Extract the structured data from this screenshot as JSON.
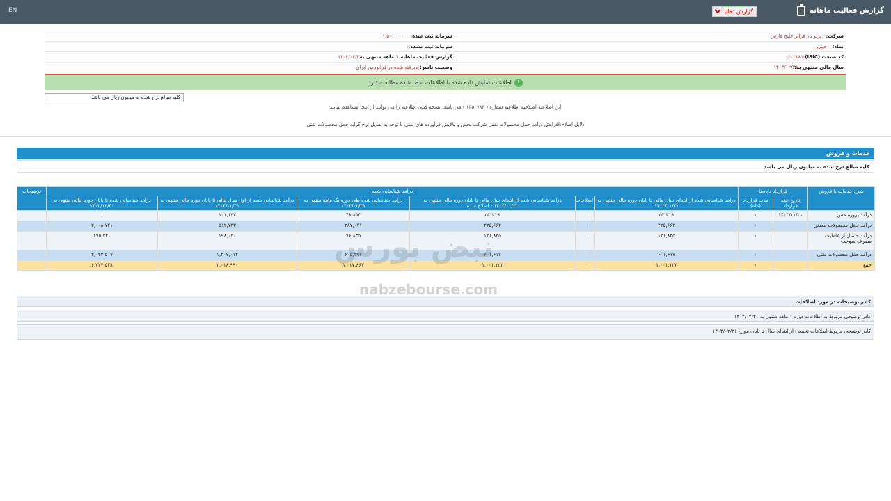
{
  "topbar": {
    "lang": "EN",
    "title": "گزارش فعالیت ماهانه",
    "select_value": "گزارش تخالیت"
  },
  "info": {
    "company_label": "شرکت:",
    "company_value": "پرتو بار فرابر خلیج فارس",
    "symbol_label": "نماد:",
    "symbol_value": "حپترو",
    "isic_label": "کد صنعت (ISIC):",
    "isic_value": "۶۰۲۱۸۱",
    "fiscal_label": "سال مالی منتهی به:",
    "fiscal_value": "۱۴۰۴/۱۲/۲۹",
    "reg_capital_label": "سرمایه ثبت شده:",
    "reg_capital_value": "۱,۵۰۰,۰۰۰",
    "unreg_capital_label": "سرمایه ثبت نشده:",
    "unreg_capital_value": "۰",
    "report_label": "گزارش فعالیت ماهانه ۱ ماهه منتهی به",
    "report_value": "۱۴۰۴/۰۲/۳۱",
    "status_label": "وضعیت ناشر:",
    "status_value": "پذیرفته شده در فرابورس ایران"
  },
  "green_msg": "اطلاعات نمایش داده شده با اطلاعات امضا شده مطابقت دارد",
  "unit_box": "کلیه مبالغ درج شده به میلیون ریال می باشد",
  "note1": "این اطلاعیه اصلاحیه اطلاعیه شماره ( ۱۳۵۰۷۸۴ ) می باشد. نسخه قبلی اطلاعیه را می توانید از اینجا مشاهده نمایید",
  "note2": "دلایل اصلاح:افزایش درآمد حمل محصولات نفتی شرکت پخش و پالایش فرآورده هاي نفتي با توجه به تعدیل نرخ کرایه حمل محصولات نفتي",
  "section": {
    "title": "خدمات و فروش",
    "subtitle": "کلیه مبالغ درج شده به میلیون ریال می باشد"
  },
  "table": {
    "h_service": "شرح خدمات یا فروش",
    "h_contract": "قرارداد داده‌ها",
    "h_contract_date": "تاریخ عقد قرارداد",
    "h_contract_duration": "مدت قرارداد (ماه)",
    "h_revenue": "درآمد شناسایی شده",
    "h_explanations": "توضیحات",
    "h_rev_1": "درآمد شناسایی شده از ابتدای سال مالی تا پایان دوره مالی منتهی به ۱۴۰۴/۰۱/۳۱",
    "h_corrections": "اصلاحات",
    "h_rev_2": "درآمد شناسایی شده از ابتدای سال مالی تا پایان دوره مالی منتهی به ۱۴۰۴/۰۱/۳۱ - اصلاح شده",
    "h_rev_3": "درآمد شناسایی شده طی دوره یک ماهه منتهی به ۱۴۰۴/۰۲/۳۱",
    "h_rev_4": "درآمد شناسایی شده از اول سال مالی تا پایان دوره مالی منتهی به ۱۴۰۴/۰۲/۳۱",
    "h_rev_5": "درآمد شناسایی شده تا پایان دوره مالی منتهی به ۱۴۰۳/۱۲/۳۰",
    "rows": [
      {
        "name": "درآمد پروژه مس",
        "date": "۱۴۰۳/۱۱/۰۱",
        "dur": "۰",
        "rev1": "۵۳,۳۱۹",
        "corr": "۰",
        "rev2": "۵۳,۳۱۹",
        "rev3": "۴۸,۸۵۴",
        "rev4": "۱۰۱,۱۷۳",
        "rev5": "۰"
      },
      {
        "name": "درآمد حمل محصولات معدنی",
        "date": "",
        "dur": "۰",
        "rev1": "۲۲۵,۶۶۲",
        "corr": "۰",
        "rev2": "۲۲۵,۶۶۲",
        "rev3": "۲۸۷,۰۷۱",
        "rev4": "۵۱۲,۷۳۳",
        "rev5": "۲,۰۰۸,۷۲۱"
      },
      {
        "name": "درآمد حاصل از عاملیت مصرف سوخت",
        "date": "",
        "dur": "۰",
        "rev1": "۱۲۱,۸۳۵",
        "corr": "۰",
        "rev2": "۱۲۱,۸۳۵",
        "rev3": "۷۶,۸۳۵",
        "rev4": "۱۹۸,۰۷۰",
        "rev5": "۶۷۵,۳۲۰"
      },
      {
        "name": "درآمد حمل محصولات نفتی",
        "date": "",
        "dur": "۰",
        "rev1": "۶۰۱,۶۱۷",
        "corr": "۰",
        "rev2": "۶۰۱,۶۱۷",
        "rev3": "۶۰۵,۳۹۷",
        "rev4": "۱,۲۰۷,۰۱۴",
        "rev5": "۴,۰۴۳,۵۰۷"
      }
    ],
    "total": {
      "name": "جمع",
      "dur": "۰",
      "rev1": "۱,۰۰۱,۱۲۳",
      "corr": "۰",
      "rev2": "۱,۰۰۱,۱۲۳",
      "rev3": "۱,۰۱۷,۸۶۷",
      "rev4": "۲,۰۱۸,۹۹۰",
      "rev5": "۶,۷۲۷,۵۴۸"
    }
  },
  "watermark": {
    "fa": "نبض بورس",
    "en": "nabzebourse.com"
  },
  "explanations": {
    "header": "کادر توضیحات در مورد اصلاحات",
    "line1": "کادر توضیحی مربوط به اطلاعات دوره ۱ ماهه منتهی به ۱۴۰۴/۰۲/۳۱",
    "line2": "کادر توضیحی مربوط اطلاعات تجمعی از ابتدای سال تا پایان مورخ ۱۴۰۴/۰۲/۳۱"
  }
}
